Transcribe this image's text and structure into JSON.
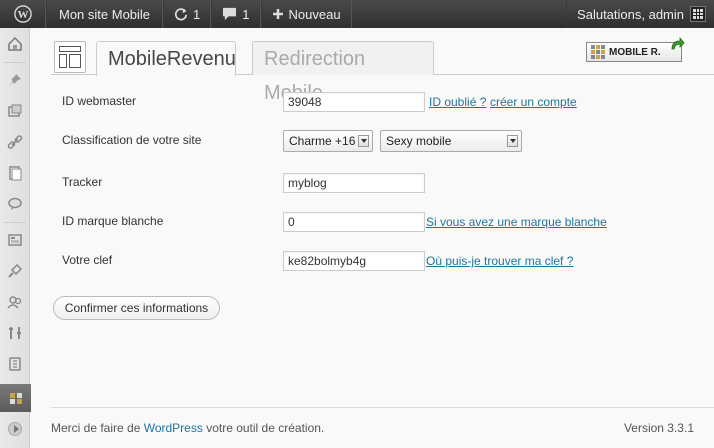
{
  "adminbar": {
    "site_name": "Mon site Mobile",
    "updates_count": "1",
    "comments_count": "1",
    "new_label": "Nouveau",
    "greeting": "Salutations, admin"
  },
  "sidebar": {
    "items": [
      "dashboard-icon",
      "pin-icon",
      "media-icon",
      "links-icon",
      "pages-icon",
      "comments-icon",
      "appearance-icon",
      "plugins-icon",
      "users-icon",
      "tools-icon",
      "settings-icon",
      "mobile-revenu-icon"
    ]
  },
  "tabs": [
    {
      "label": "MobileRevenu",
      "active": true
    },
    {
      "label": "Redirection Mobile",
      "active": false
    }
  ],
  "badge": {
    "label": "MOBILE R."
  },
  "form": {
    "webmaster": {
      "label": "ID webmaster",
      "value": "39048",
      "link1": "ID oublié ?",
      "link2": "créer un compte"
    },
    "classification": {
      "label": "Classification de votre site",
      "select1": "Charme +16",
      "select2": "Sexy mobile"
    },
    "tracker": {
      "label": "Tracker",
      "value": "myblog"
    },
    "marque": {
      "label": "ID marque blanche",
      "value": "0",
      "link": "Si vous avez une marque blanche"
    },
    "clef": {
      "label": "Votre clef",
      "value": "ke82bolmyb4g",
      "link": "Où puis-je trouver ma clef ?"
    },
    "submit_label": "Confirmer ces informations"
  },
  "footer": {
    "text_before": "Merci de faire de ",
    "link": "WordPress",
    "text_after": " votre outil de création.",
    "version": "Version 3.3.1"
  },
  "colors": {
    "link": "#21759b",
    "adminbar": "#3a3a3a"
  }
}
